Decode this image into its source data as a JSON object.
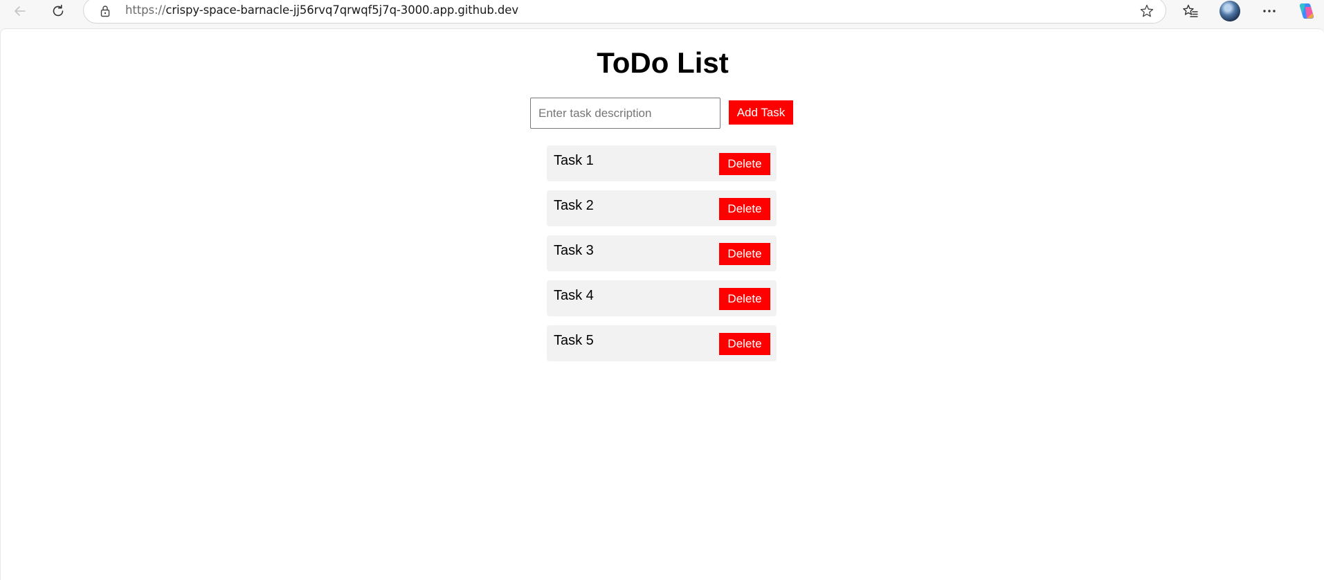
{
  "browser": {
    "url_scheme": "https://",
    "url_host": "crispy-space-barnacle-jj56rvq7qrwqf5j7q-3000.app.github.dev",
    "icons": [
      "back-icon",
      "refresh-icon",
      "lock-icon",
      "star-icon",
      "favorites-icon",
      "avatar",
      "more-icon",
      "copilot-icon"
    ]
  },
  "page": {
    "title": "ToDo List",
    "input_placeholder": "Enter task description",
    "input_value": "",
    "add_button_label": "Add Task",
    "accent_color": "#ff0000",
    "tasks": [
      {
        "text": "Task 1",
        "delete_label": "Delete"
      },
      {
        "text": "Task 2",
        "delete_label": "Delete"
      },
      {
        "text": "Task 3",
        "delete_label": "Delete"
      },
      {
        "text": "Task 4",
        "delete_label": "Delete"
      },
      {
        "text": "Task 5",
        "delete_label": "Delete"
      }
    ]
  }
}
